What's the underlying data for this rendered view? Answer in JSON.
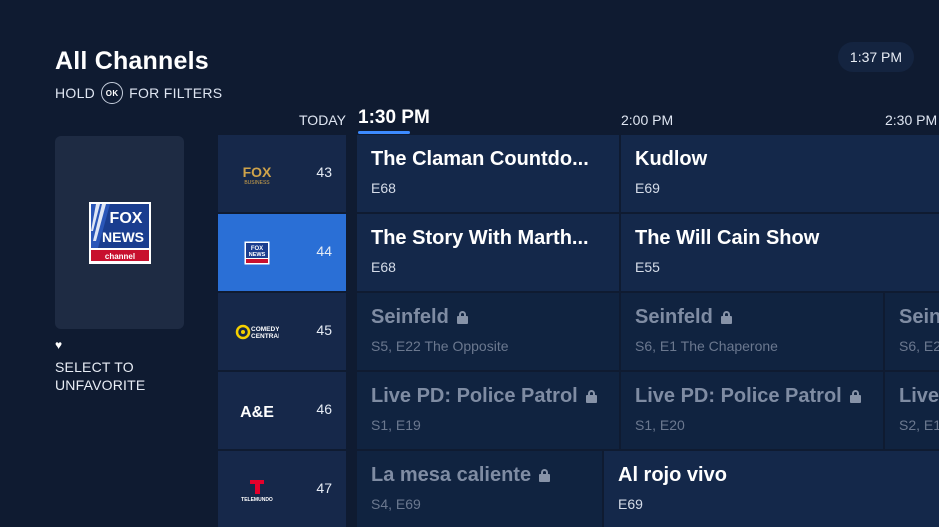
{
  "header": {
    "title": "All Channels",
    "hold_label": "HOLD",
    "ok_label": "OK",
    "filters_label": "FOR FILTERS",
    "clock": "1:37 PM"
  },
  "preview": {
    "logo": "fox-news-channel-logo",
    "favorite_icon": "heart-icon",
    "favorite_text_line1": "SELECT TO",
    "favorite_text_line2": "UNFAVORITE"
  },
  "timeline": {
    "day": "TODAY",
    "now": "1:30 PM",
    "slot2": "2:00 PM",
    "slot3": "2:30 PM"
  },
  "channels": [
    {
      "number": "43",
      "logo": "fox-business-logo",
      "programs": [
        {
          "title": "The Claman Countdo...",
          "detail": "E68",
          "locked": false
        },
        {
          "title": "Kudlow",
          "detail": "E69",
          "locked": false
        }
      ]
    },
    {
      "number": "44",
      "logo": "fox-news-logo",
      "selected": true,
      "programs": [
        {
          "title": "The Story With Marth...",
          "detail": "E68",
          "locked": false
        },
        {
          "title": "The Will Cain Show",
          "detail": "E55",
          "locked": false
        }
      ]
    },
    {
      "number": "45",
      "logo": "comedy-central-logo",
      "programs": [
        {
          "title": "Seinfeld",
          "detail": "S5, E22 The Opposite",
          "locked": true
        },
        {
          "title": "Seinfeld",
          "detail": "S6, E1 The Chaperone",
          "locked": true
        },
        {
          "title": "Sein",
          "detail": "S6, E2",
          "locked": false
        }
      ]
    },
    {
      "number": "46",
      "logo": "a-and-e-logo",
      "programs": [
        {
          "title": "Live PD: Police Patrol",
          "detail": "S1, E19",
          "locked": true
        },
        {
          "title": "Live PD: Police Patrol",
          "detail": "S1, E20",
          "locked": true
        },
        {
          "title": "Live",
          "detail": "S2, E1",
          "locked": false
        }
      ]
    },
    {
      "number": "47",
      "logo": "telemundo-logo",
      "programs": [
        {
          "title": "La mesa caliente",
          "detail": "S4, E69",
          "locked": true
        },
        {
          "title": "Al rojo vivo",
          "detail": "E69",
          "locked": false
        }
      ]
    }
  ],
  "colors": {
    "background": "#0f1b31",
    "selected_channel": "#2a6fd6",
    "now_indicator": "#3d8bff"
  }
}
